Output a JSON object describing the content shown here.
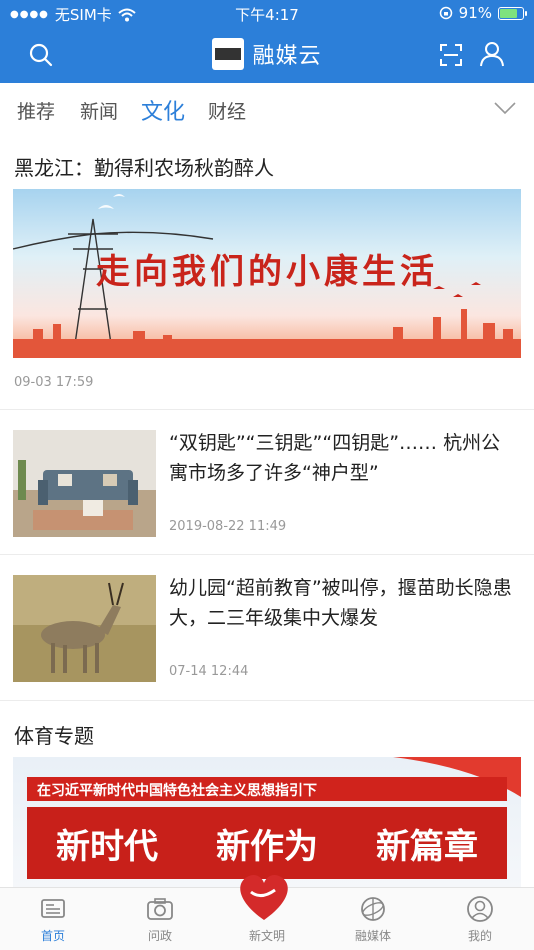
{
  "status": {
    "carrier": "无SIM卡",
    "time": "下午4:17",
    "battery": "91%"
  },
  "header": {
    "title": "融媒云"
  },
  "tabs": [
    {
      "label": "推荐"
    },
    {
      "label": "新闻"
    },
    {
      "label": "文化"
    },
    {
      "label": "财经"
    }
  ],
  "feature": {
    "title": "黑龙江：勤得利农场秋韵醉人",
    "banner_text": "走向我们的小康生活",
    "date": "09-03 17:59"
  },
  "articles": [
    {
      "title": "“双钥匙”“三钥匙”“四钥匙”…… 杭州公寓市场多了许多“神户型”",
      "time": "2019-08-22 11:49"
    },
    {
      "title": "幼儿园“超前教育”被叫停，揠苗助长隐患大，二三年级集中大爆发",
      "time": "07-14 12:44"
    }
  ],
  "section": {
    "title": "体育专题",
    "banner_strip": "在习近平新时代中国特色社会主义思想指引下",
    "banner_words": [
      "新时代",
      "新作为",
      "新篇章"
    ]
  },
  "tabbar": [
    {
      "label": "首页"
    },
    {
      "label": "问政"
    },
    {
      "label": "新文明"
    },
    {
      "label": "融媒体"
    },
    {
      "label": "我的"
    }
  ],
  "colors": {
    "brand": "#2c7fd9",
    "banner_red": "#c8201a"
  }
}
